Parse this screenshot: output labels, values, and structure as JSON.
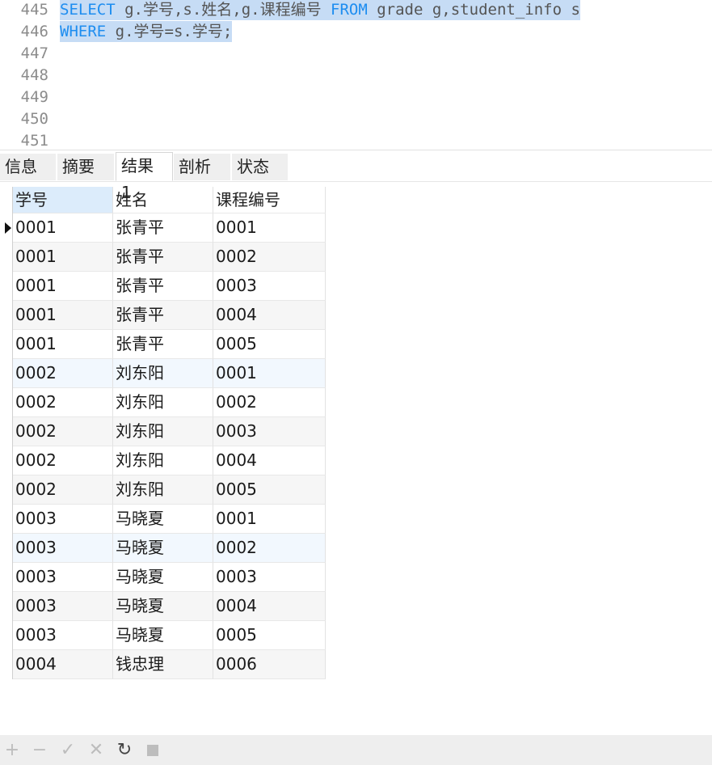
{
  "editor": {
    "lines": [
      {
        "num": "445",
        "segments": [
          {
            "text": "SELECT",
            "kw": true
          },
          {
            "text": " g.学号,s.姓名,g.课程编号 ",
            "kw": false
          },
          {
            "text": "FROM",
            "kw": true
          },
          {
            "text": " grade g,student_info s",
            "kw": false
          }
        ],
        "selected": true
      },
      {
        "num": "446",
        "segments": [
          {
            "text": "WHERE",
            "kw": true
          },
          {
            "text": " g.学号=s.学号;",
            "kw": false
          }
        ],
        "selected": true
      },
      {
        "num": "447",
        "segments": [],
        "selected": false
      },
      {
        "num": "448",
        "segments": [],
        "selected": false
      },
      {
        "num": "449",
        "segments": [],
        "selected": false
      },
      {
        "num": "450",
        "segments": [],
        "selected": false
      },
      {
        "num": "451",
        "segments": [],
        "selected": false
      }
    ]
  },
  "tabs": [
    {
      "label": "信息",
      "active": false
    },
    {
      "label": "摘要",
      "active": false
    },
    {
      "label": "结果 1",
      "active": true
    },
    {
      "label": "剖析",
      "active": false
    },
    {
      "label": "状态",
      "active": false
    }
  ],
  "results": {
    "columns": [
      "学号",
      "姓名",
      "课程编号"
    ],
    "rows": [
      [
        "0001",
        "张青平",
        "0001"
      ],
      [
        "0001",
        "张青平",
        "0002"
      ],
      [
        "0001",
        "张青平",
        "0003"
      ],
      [
        "0001",
        "张青平",
        "0004"
      ],
      [
        "0001",
        "张青平",
        "0005"
      ],
      [
        "0002",
        "刘东阳",
        "0001"
      ],
      [
        "0002",
        "刘东阳",
        "0002"
      ],
      [
        "0002",
        "刘东阳",
        "0003"
      ],
      [
        "0002",
        "刘东阳",
        "0004"
      ],
      [
        "0002",
        "刘东阳",
        "0005"
      ],
      [
        "0003",
        "马晓夏",
        "0001"
      ],
      [
        "0003",
        "马晓夏",
        "0002"
      ],
      [
        "0003",
        "马晓夏",
        "0003"
      ],
      [
        "0003",
        "马晓夏",
        "0004"
      ],
      [
        "0003",
        "马晓夏",
        "0005"
      ],
      [
        "0004",
        "钱忠理",
        "0006"
      ]
    ],
    "current_row": 1
  },
  "toolbar": {
    "buttons": [
      {
        "name": "add-row-button",
        "glyph": "+",
        "enabled": false
      },
      {
        "name": "delete-row-button",
        "glyph": "−",
        "enabled": false
      },
      {
        "name": "apply-changes-button",
        "glyph": "✓",
        "enabled": false
      },
      {
        "name": "discard-changes-button",
        "glyph": "✕",
        "enabled": false
      },
      {
        "name": "refresh-button",
        "glyph": "↻",
        "enabled": true
      },
      {
        "name": "stop-button",
        "glyph": "■",
        "enabled": false
      }
    ]
  },
  "colors": {
    "keyword": "#1d8df0",
    "selection": "#c6dcf5",
    "header_selected": "#dcecfb"
  }
}
